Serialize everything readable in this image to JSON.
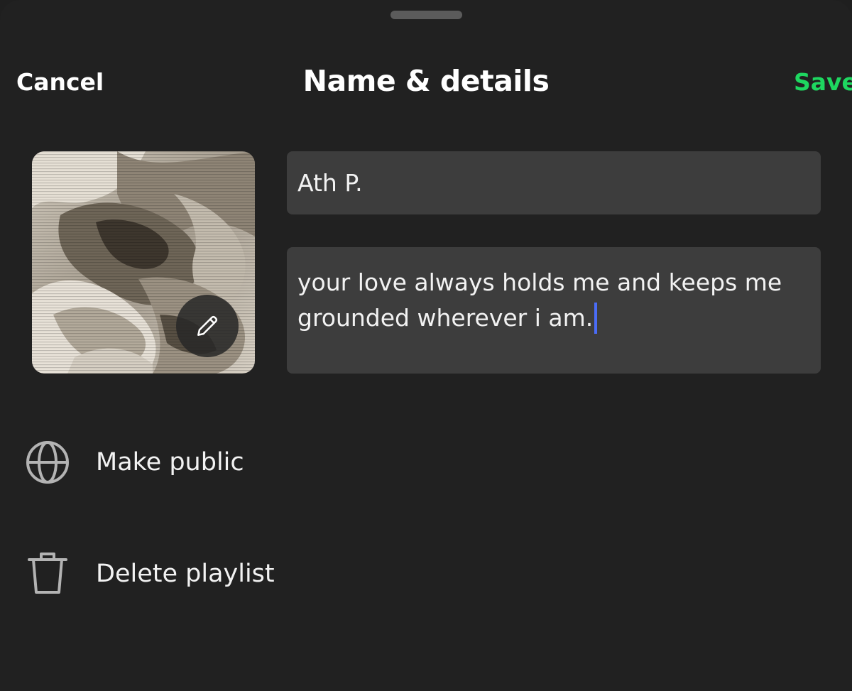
{
  "header": {
    "cancel_label": "Cancel",
    "title": "Name & details",
    "save_label": "Save"
  },
  "playlist": {
    "name": "Ath P.",
    "description": "your love always holds me and keeps me grounded wherever i am."
  },
  "options": {
    "make_public_label": "Make public",
    "delete_label": "Delete playlist"
  },
  "icons": {
    "edit": "pencil-icon",
    "public": "globe-icon",
    "delete": "trash-icon"
  },
  "colors": {
    "background": "#212121",
    "field": "#3d3d3d",
    "accent": "#1ed760",
    "caret": "#4a6cf7",
    "icon": "#b3b3b3"
  }
}
